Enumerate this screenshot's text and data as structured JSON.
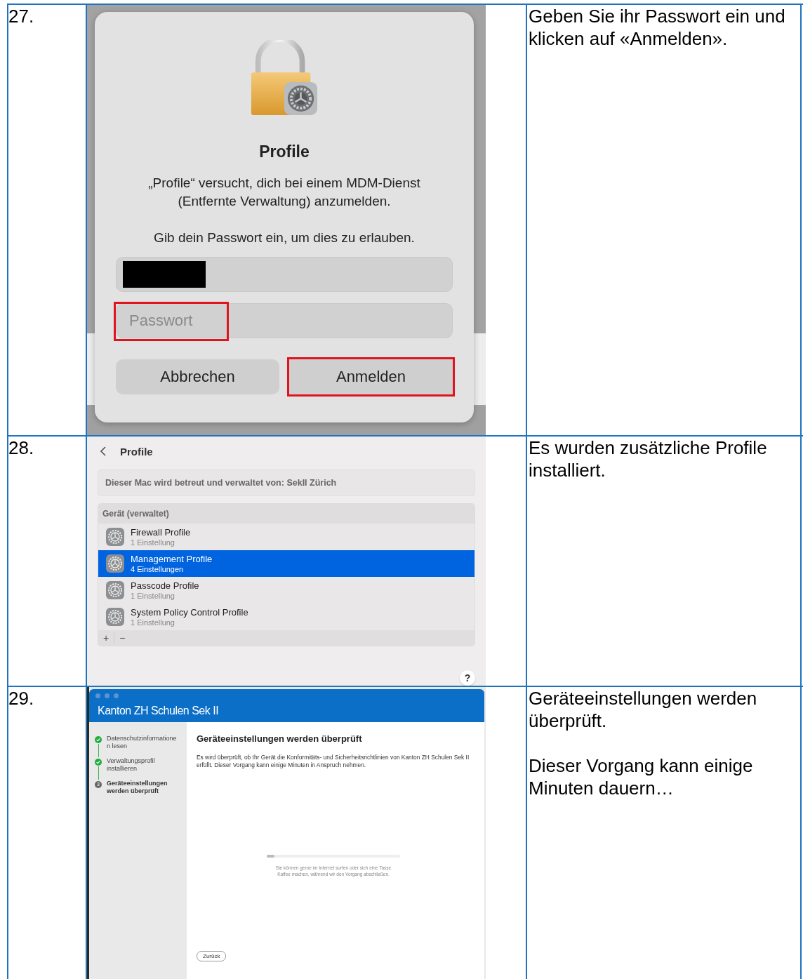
{
  "steps": [
    {
      "number": "27.",
      "kind": "password_dialog",
      "screen": {
        "title": "Profile",
        "message": "„Profile“ versucht, dich bei einem MDM-Dienst (Entfernte Verwaltung) anzumelden.",
        "prompt": "Gib dein Passwort ein, um dies zu erlauben.",
        "username_field": {
          "redacted": true
        },
        "password_field": {
          "placeholder": "Passwort",
          "highlighted": true
        },
        "buttons": [
          {
            "label": "Abbrechen",
            "highlighted": false
          },
          {
            "label": "Anmelden",
            "highlighted": true
          }
        ]
      },
      "description": [
        "Geben Sie ihr Passwort ein und klicken auf «Anmelden»."
      ]
    },
    {
      "number": "28.",
      "kind": "profiles_list",
      "screen": {
        "title": "Profile",
        "managed_notice": "Dieser Mac wird betreut und verwaltet von: SekII Zürich",
        "section": "Gerät (verwaltet)",
        "profiles": [
          {
            "name": "Firewall Profile",
            "detail": "1 Einstellung",
            "selected": false
          },
          {
            "name": "Management Profile",
            "detail": "4 Einstellungen",
            "selected": true
          },
          {
            "name": "Passcode Profile",
            "detail": "1 Einstellung",
            "selected": false
          },
          {
            "name": "System Policy Control Profile",
            "detail": "1 Einstellung",
            "selected": false
          }
        ],
        "add_label": "+",
        "remove_label": "−",
        "help_label": "?"
      },
      "description": [
        "Es wurden zusätzliche Profile installiert."
      ]
    },
    {
      "number": "29.",
      "kind": "enrollment_window",
      "screen": {
        "app_title": "Kanton ZH Schulen Sek II",
        "steps": [
          {
            "label": "Datenschutzinformationen lesen",
            "done": true
          },
          {
            "label": "Verwaltungsprofil installieren",
            "done": true
          },
          {
            "label": "Geräteeinstellungen werden überprüft",
            "done": false,
            "number": "3"
          }
        ],
        "heading": "Geräteeinstellungen werden überprüft",
        "body": "Es wird überprüft, ob Ihr Gerät die Konformitäts- und Sicherheitsrichtlinien von Kanton ZH Schulen Sek II erfüllt. Dieser Vorgang kann einige Minuten in Anspruch nehmen.",
        "progress": {
          "level": 0.06
        },
        "hint": "Sie können gerne im Internet surfen oder sich eine Tasse Kaffee machen, während wir den Vorgang abschließen.",
        "back_button": "Zurück"
      },
      "description": [
        "Geräteeinstellungen werden überprüft.",
        "Dieser Vorgang kann einige Minuten dauern…"
      ]
    }
  ]
}
